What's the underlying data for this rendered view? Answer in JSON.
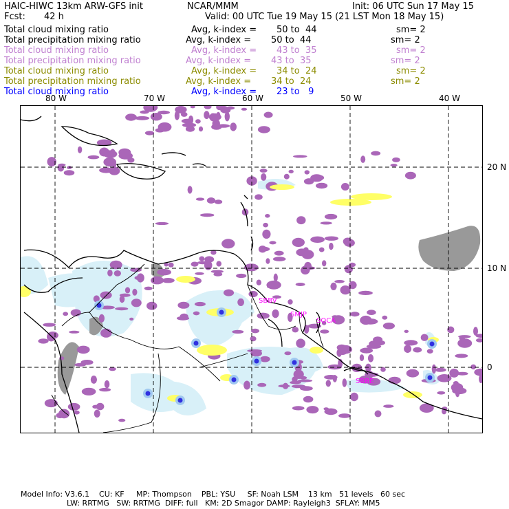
{
  "header": {
    "model_title": "HAIC-HIWC 13km ARW-GFS init",
    "org": "NCAR/MMM",
    "init": "Init: 06 UTC Sun 17 May 15",
    "fcst_label": "Fcst:",
    "fcst_value": "42 h",
    "valid": "Valid: 00 UTC Tue 19 May 15 (21 LST Mon 18 May 15)"
  },
  "legend": [
    {
      "name": "Total cloud mixing ratio",
      "avg": "Avg, k-index =",
      "range": "50 to  44",
      "sm": "sm= 2",
      "color": "#000000"
    },
    {
      "name": "Total precipitation mixing ratio",
      "avg": "Avg, k-index =",
      "range": "50 to  44",
      "sm": "sm= 2",
      "color": "#000000"
    },
    {
      "name": "Total cloud mixing ratio",
      "avg": "Avg, k-index =",
      "range": "43 to  35",
      "sm": "sm= 2",
      "color": "#c080d0"
    },
    {
      "name": "Total precipitation mixing ratio",
      "avg": "Avg, k-index =",
      "range": "43 to  35",
      "sm": "sm= 2",
      "color": "#c080d0"
    },
    {
      "name": "Total cloud mixing ratio",
      "avg": "Avg, k-index =",
      "range": "34 to  24",
      "sm": "sm= 2",
      "color": "#8c8c00"
    },
    {
      "name": "Total precipitation mixing ratio",
      "avg": "Avg, k-index =",
      "range": "34 to  24",
      "sm": "sm= 2",
      "color": "#8c8c00"
    },
    {
      "name": "Total cloud mixing ratio",
      "avg": "Avg, k-index =",
      "range": "23 to   9",
      "sm": "",
      "color": "#0000ff"
    }
  ],
  "map": {
    "lon_labels": [
      "80 W",
      "70 W",
      "60 W",
      "50 W",
      "40 W"
    ],
    "lat_labels": [
      "20 N",
      "10 N",
      "0"
    ],
    "station_labels": [
      "SBBV",
      "SMJP",
      "SOCA",
      "SBBE"
    ],
    "colors": {
      "purple": "#aa66b8",
      "lightblue": "#d8f0f8",
      "gray": "#999999",
      "yellow": "#ffff66",
      "blue": "#3030e0",
      "station": "#ff00ff"
    }
  },
  "footer": {
    "line1": "Model Info: V3.6.1    CU: KF     MP: Thompson    PBL: YSU     SF: Noah LSM    13 km   51 levels   60 sec",
    "line2": "LW: RRTMG   SW: RRTMG  DIFF: full   KM: 2D Smagor DAMP: Rayleigh3  SFLAY: MM5"
  }
}
